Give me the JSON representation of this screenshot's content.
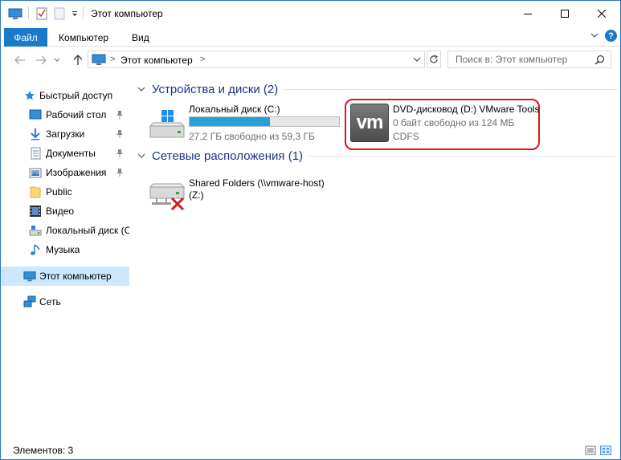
{
  "window": {
    "title": "Этот компьютер",
    "accent": "#1979ca"
  },
  "ribbon": {
    "tabs": [
      {
        "label": "Файл"
      },
      {
        "label": "Компьютер"
      },
      {
        "label": "Вид"
      }
    ],
    "help": "?"
  },
  "address": {
    "path": "Этот компьютер",
    "separator": ">",
    "search_placeholder": "Поиск в: Этот компьютер"
  },
  "sidebar": {
    "items": [
      {
        "label": "Быстрый доступ",
        "icon": "star-icon"
      },
      {
        "label": "Рабочий стол",
        "icon": "desktop-icon",
        "pinned": true
      },
      {
        "label": "Загрузки",
        "icon": "download-arrow-icon",
        "pinned": true
      },
      {
        "label": "Документы",
        "icon": "document-icon",
        "pinned": true
      },
      {
        "label": "Изображения",
        "icon": "pictures-icon",
        "pinned": true
      },
      {
        "label": "Public",
        "icon": "folder-icon"
      },
      {
        "label": "Видео",
        "icon": "film-icon"
      },
      {
        "label": "Локальный диск (C",
        "icon": "drive-icon"
      },
      {
        "label": "Музыка",
        "icon": "music-note-icon"
      },
      {
        "label": "Этот компьютер",
        "icon": "computer-icon",
        "selected": true
      },
      {
        "label": "Сеть",
        "icon": "network-icon"
      }
    ]
  },
  "groups": {
    "devices": {
      "header": "Устройства и диски (2)",
      "drives": [
        {
          "name": "Локальный диск (C:)",
          "sub": "27,2 ГБ свободно из 59,3 ГБ",
          "used_fraction": 0.54,
          "icon": "windows-drive-icon"
        },
        {
          "name": "DVD-дисковод (D:) VMware Tools",
          "sub": "0 байт свободно из 124 МБ",
          "fs": "CDFS",
          "icon": "vmware-logo-icon",
          "logo_text": "vm",
          "highlighted": true
        }
      ]
    },
    "network": {
      "header": "Сетевые расположения (1)",
      "items": [
        {
          "name": "Shared Folders (\\\\vmware-host)",
          "sub": "(Z:)",
          "icon": "disconnected-network-drive-icon"
        }
      ]
    }
  },
  "status": {
    "text": "Элементов: 3"
  },
  "colors": {
    "group_header": "#1e3287",
    "progress_fill": "#26a0da",
    "highlight_border": "#e0141e",
    "selected_bg": "#cce8ff"
  }
}
